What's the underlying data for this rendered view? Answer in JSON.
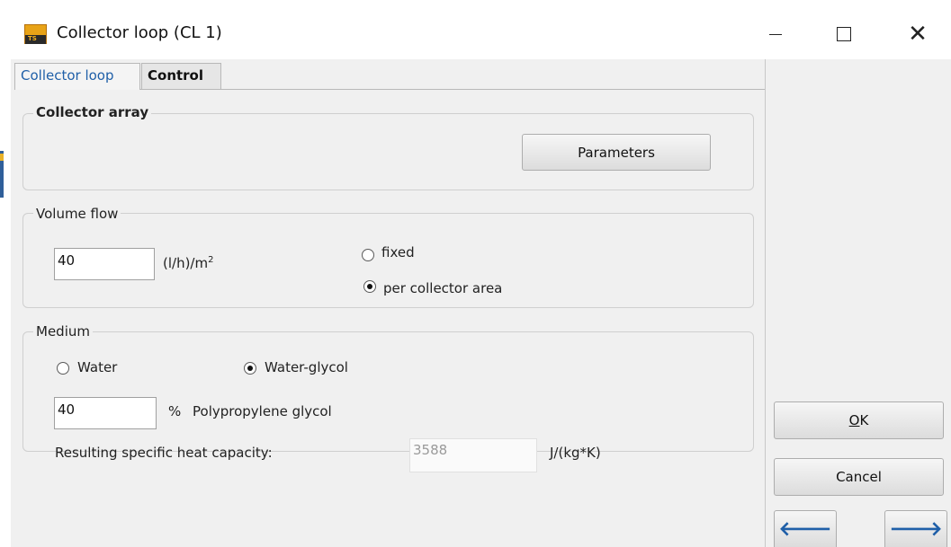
{
  "window": {
    "title": "Collector loop  (CL 1)",
    "minimize_icon": "minimize-icon",
    "maximize_icon": "maximize-icon",
    "close_glyph": "✕"
  },
  "tabs": [
    {
      "label": "Collector loop",
      "active": true
    },
    {
      "label": "Control",
      "active": false
    }
  ],
  "collector_array": {
    "title": "Collector array",
    "parameters_button": "Parameters"
  },
  "volume_flow": {
    "title": "Volume flow",
    "value": "40",
    "unit_base": "(l/h)/m",
    "unit_sup": "2",
    "options": [
      {
        "label": "fixed",
        "selected": false
      },
      {
        "label": "per collector area",
        "selected": true
      }
    ]
  },
  "medium": {
    "title": "Medium",
    "options": [
      {
        "label": "Water",
        "selected": false
      },
      {
        "label": "Water-glycol",
        "selected": true
      }
    ],
    "glycol_value": "40",
    "percent_symbol": "%",
    "glycol_label": "Polypropylene glycol",
    "heat_capacity_label": "Resulting specific heat capacity:",
    "heat_capacity_value": "3588",
    "heat_capacity_unit": "J/(kg*K)"
  },
  "actions": {
    "ok_mnemonic": "O",
    "ok_rest": "K",
    "cancel": "Cancel",
    "back_glyph": "🡐",
    "forward_glyph": "🡒"
  },
  "colors": {
    "accent": "#1f5fa8",
    "dialog_bg": "#f0f0f0"
  }
}
